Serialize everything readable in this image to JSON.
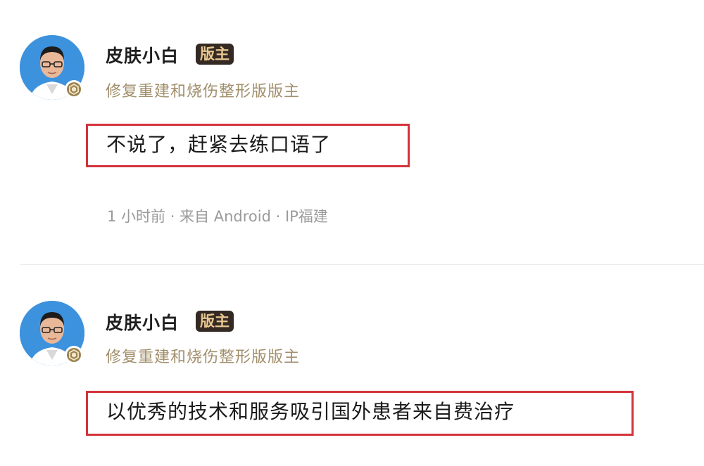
{
  "posts": [
    {
      "username": "皮肤小白",
      "role_tag": "版主",
      "subtitle": "修复重建和烧伤整形版版主",
      "content": "不说了，赶紧去练口语了",
      "meta": "1 小时前 · 来自 Android · IP福建"
    },
    {
      "username": "皮肤小白",
      "role_tag": "版主",
      "subtitle": "修复重建和烧伤整形版版主",
      "content": "以优秀的技术和服务吸引国外患者来自费治疗"
    }
  ],
  "colors": {
    "highlight_border": "#d3333b",
    "role_tag_bg": "#352a23",
    "role_tag_text": "#e8c790",
    "subtitle_text": "#a18f6c",
    "avatar_bg": "#3d92de"
  },
  "icons": {
    "avatar": "person-photo",
    "verified_badge": "hexagon-badge-icon"
  }
}
